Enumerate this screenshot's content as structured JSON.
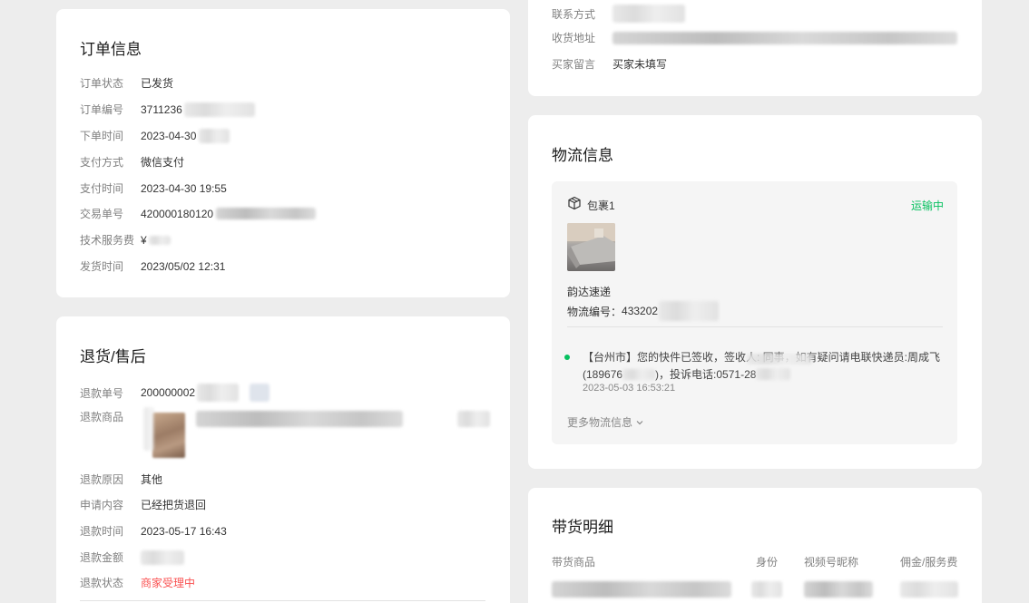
{
  "order_info": {
    "title": "订单信息",
    "rows": [
      {
        "label": "订单状态",
        "value": "已发货"
      },
      {
        "label": "订单编号",
        "value": "3711236"
      },
      {
        "label": "下单时间",
        "value": "2023-04-30"
      },
      {
        "label": "支付方式",
        "value": "微信支付"
      },
      {
        "label": "支付时间",
        "value": "2023-04-30 19:55"
      },
      {
        "label": "交易单号",
        "value": "420000180120"
      },
      {
        "label": "技术服务费",
        "value": "¥"
      },
      {
        "label": "发货时间",
        "value": "2023/05/02 12:31"
      }
    ]
  },
  "refund": {
    "title": "退货/售后",
    "rows": [
      {
        "label": "退款单号",
        "value": "200000002"
      },
      {
        "label": "退款商品",
        "value": ""
      },
      {
        "label": "退款原因",
        "value": "其他"
      },
      {
        "label": "申请内容",
        "value": "已经把货退回"
      },
      {
        "label": "退款时间",
        "value": "2023-05-17 16:43"
      },
      {
        "label": "退款金额",
        "value": ""
      },
      {
        "label": "退款状态",
        "value": "商家受理中"
      }
    ]
  },
  "buyer": {
    "rows": [
      {
        "label": "联系方式",
        "value": ""
      },
      {
        "label": "收货地址",
        "value": ""
      },
      {
        "label": "买家留言",
        "value": "买家未填写"
      }
    ]
  },
  "logistics": {
    "title": "物流信息",
    "package_label": "包裹1",
    "package_status": "运输中",
    "carrier": "韵达速递",
    "tracking_label": "物流编号：",
    "tracking_no": "433202",
    "event_text_1": "【台州市】您的快件已签收，签收人: 同事，如有疑问请电联快递员:周成飞",
    "event_text_2": "(189676",
    "event_text_3": ")，投诉电话:0571-28",
    "event_time": "2023-05-03 16:53:21",
    "more_label": "更多物流信息",
    "colors": {
      "accent": "#07c160",
      "alert": "#fa5151"
    }
  },
  "promo": {
    "title": "带货明细",
    "columns": [
      "带货商品",
      "身份",
      "视频号昵称",
      "佣金/服务费"
    ]
  }
}
